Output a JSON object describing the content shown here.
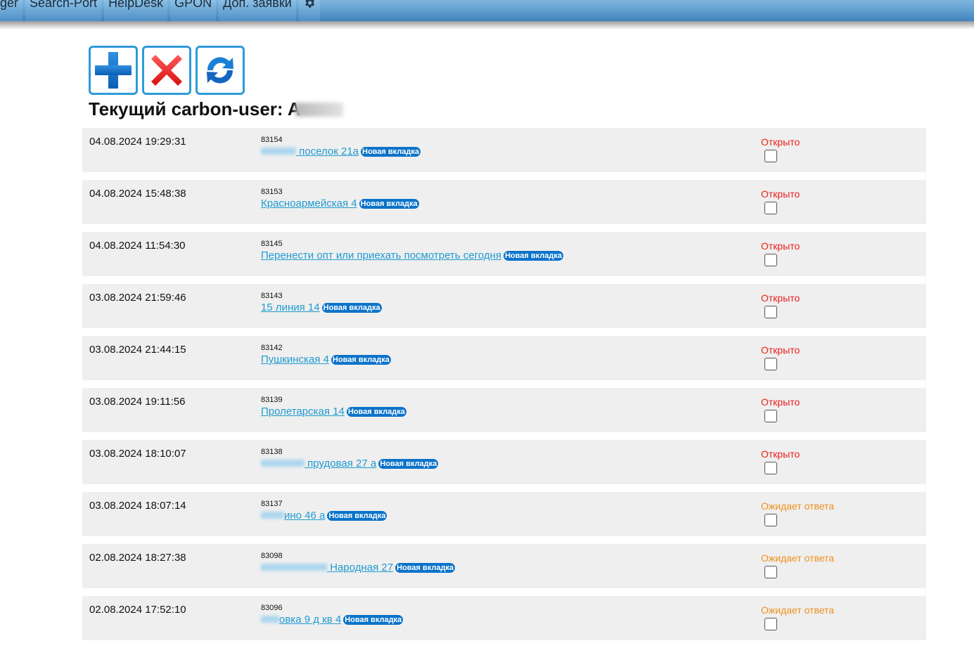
{
  "nav": {
    "items": [
      "ger",
      "Search-Port",
      "HelpDesk",
      "GPON",
      "Доп. заявки"
    ],
    "settings_icon": "gear-icon"
  },
  "toolbar": {
    "add_icon": "plus-icon",
    "delete_icon": "x-icon",
    "refresh_icon": "refresh-icon"
  },
  "header": {
    "label": "Текущий carbon-user: A"
  },
  "colors": {
    "open": "#ee1d1d",
    "waiting": "#f0901e",
    "link": "#1f9bd1",
    "badge": "#0b73c9"
  },
  "tickets": [
    {
      "date": "04.08.2024 19:29:31",
      "id": "83154",
      "title": "поселок 21а",
      "badge": "Новая вкладка",
      "status": "Открыто",
      "state": "open"
    },
    {
      "date": "04.08.2024 15:48:38",
      "id": "83153",
      "title": "Красноармейская 4",
      "badge": "Новая вкладка",
      "status": "Открыто",
      "state": "open"
    },
    {
      "date": "04.08.2024 11:54:30",
      "id": "83145",
      "title": "Перенести опт или приехать посмотреть сегодня",
      "badge": "Новая вкладка",
      "status": "Открыто",
      "state": "open"
    },
    {
      "date": "03.08.2024 21:59:46",
      "id": "83143",
      "title": "15 линия 14",
      "badge": "Новая вкладка",
      "status": "Открыто",
      "state": "open"
    },
    {
      "date": "03.08.2024 21:44:15",
      "id": "83142",
      "title": "Пушкинская 4",
      "badge": "Новая вкладка",
      "status": "Открыто",
      "state": "open"
    },
    {
      "date": "03.08.2024 19:11:56",
      "id": "83139",
      "title": "Пролетарская 14",
      "badge": "Новая вкладка",
      "status": "Открыто",
      "state": "open"
    },
    {
      "date": "03.08.2024 18:10:07",
      "id": "83138",
      "title": "прудовая 27 а",
      "badge": "Новая вкладка",
      "status": "Открыто",
      "state": "open"
    },
    {
      "date": "03.08.2024 18:07:14",
      "id": "83137",
      "title": "ино 46 а",
      "badge": "Новая вкладка",
      "status": "Ожидает ответа",
      "state": "wait"
    },
    {
      "date": "02.08.2024 18:27:38",
      "id": "83098",
      "title": "Народная 27",
      "badge": "Новая вкладка",
      "status": "Ожидает ответа",
      "state": "wait"
    },
    {
      "date": "02.08.2024 17:52:10",
      "id": "83096",
      "title": "овка 9 д кв 4",
      "badge": "Новая вкладка",
      "status": "Ожидает ответа",
      "state": "wait"
    }
  ]
}
